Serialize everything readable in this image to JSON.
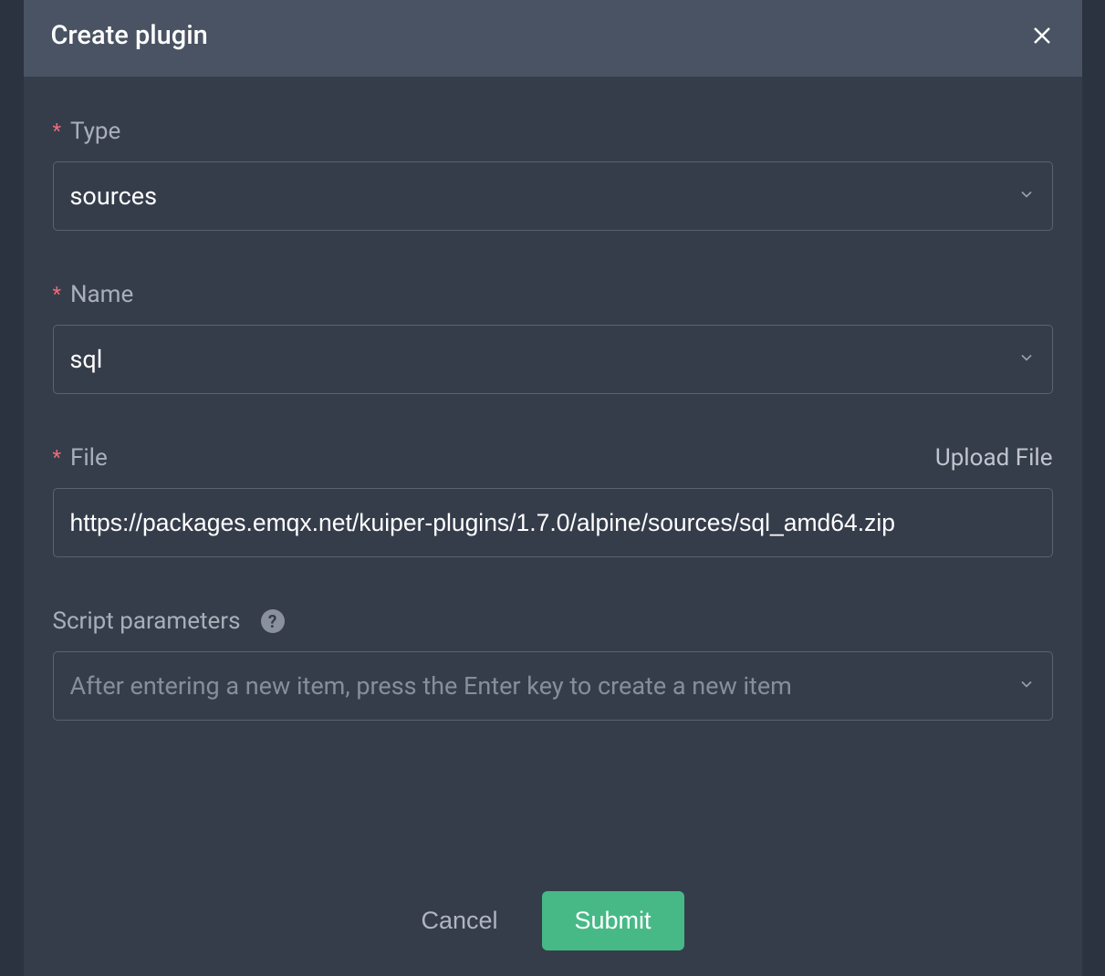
{
  "modal": {
    "title": "Create plugin",
    "fields": {
      "type": {
        "label": "Type",
        "required": true,
        "value": "sources"
      },
      "name": {
        "label": "Name",
        "required": true,
        "value": "sql"
      },
      "file": {
        "label": "File",
        "required": true,
        "upload_link": "Upload File",
        "value": "https://packages.emqx.net/kuiper-plugins/1.7.0/alpine/sources/sql_amd64.zip"
      },
      "script_parameters": {
        "label": "Script parameters",
        "required": false,
        "placeholder": "After entering a new item, press the Enter key to create a new item"
      }
    },
    "actions": {
      "cancel": "Cancel",
      "submit": "Submit"
    }
  }
}
